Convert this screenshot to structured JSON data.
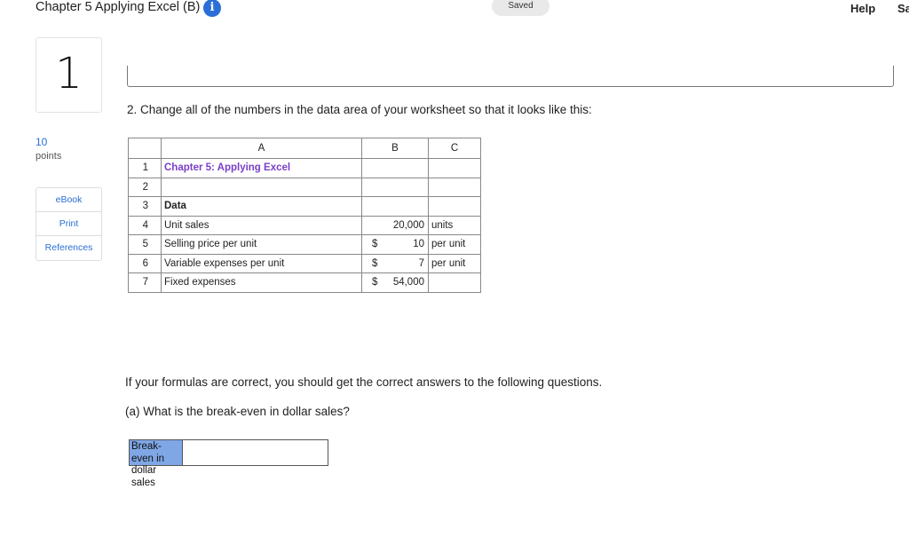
{
  "header": {
    "title": "Chapter 5 Applying Excel (B)",
    "info_glyph": "i",
    "saved": "Saved",
    "help": "Help",
    "save_partial": "Sa"
  },
  "question": {
    "number": "1",
    "points_value": "10",
    "points_label": "points",
    "links": [
      "eBook",
      "Print",
      "References"
    ],
    "prompt": "2. Change all of the numbers in the data area of your worksheet so that it looks like this:"
  },
  "sheet": {
    "columns": [
      "A",
      "B",
      "C"
    ],
    "rows": [
      {
        "n": "1",
        "a": "Chapter 5: Applying Excel",
        "b_sym": "",
        "b_val": "",
        "c": ""
      },
      {
        "n": "2",
        "a": "",
        "b_sym": "",
        "b_val": "",
        "c": ""
      },
      {
        "n": "3",
        "a": "Data",
        "b_sym": "",
        "b_val": "",
        "c": ""
      },
      {
        "n": "4",
        "a": "Unit sales",
        "b_sym": "",
        "b_val": "20,000",
        "c": "units"
      },
      {
        "n": "5",
        "a": "Selling price per unit",
        "b_sym": "$",
        "b_val": "10",
        "c": "per unit"
      },
      {
        "n": "6",
        "a": "Variable expenses per unit",
        "b_sym": "$",
        "b_val": "7",
        "c": "per unit"
      },
      {
        "n": "7",
        "a": "Fixed expenses",
        "b_sym": "$",
        "b_val": "54,000",
        "c": ""
      }
    ]
  },
  "followup": "If your formulas are correct, you should get the correct answers to the following questions.",
  "subquestion": "(a) What is the break-even in dollar sales?",
  "answer": {
    "label": "Break-even in dollar sales",
    "value": ""
  },
  "colors": {
    "accent": "#2a6fd6",
    "title_cell": "#7a3fc9",
    "answer_label_bg": "#7fa7e6"
  }
}
